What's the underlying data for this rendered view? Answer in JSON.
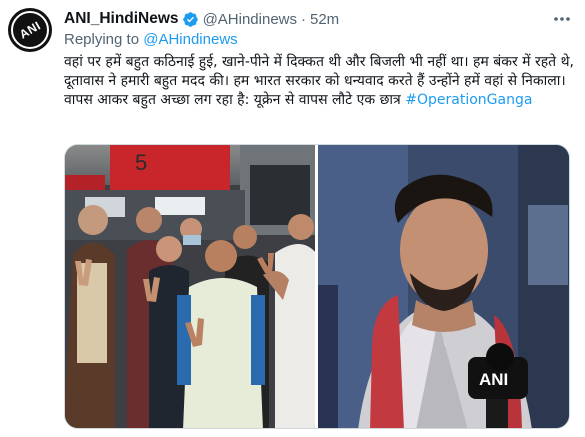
{
  "tweet": {
    "display_name": "ANI_HindiNews",
    "handle": "@AHindinews",
    "separator": "·",
    "time": "52m",
    "reply_prefix": "Replying to",
    "reply_handle": "@AHindinews",
    "text": "वहां पर हमें बहुत कठिनाई हुई, खाने-पीने में दिक्कत थी और बिजली भी नहीं था। हम बंकर में रहते थे, दूतावास ने हमारी बहुत मदद की। हम भारत सरकार को धन्यवाद करते हैं उन्होंने हमें वहां से निकाला। वापस आकर बहुत अच्छा लग रहा है: यूक्रेन से वापस लौटे एक छात्र",
    "hashtag": "#OperationGanga",
    "avatar_logo_text": "ANI",
    "photo_logo_text": "ANI",
    "board_number": "5",
    "verified_icon": "verified-badge-icon",
    "more_icon": "more-horizontal-icon"
  },
  "colors": {
    "link": "#1d9bf0",
    "secondary_text": "#536471",
    "primary_text": "#0f1419",
    "verified": "#1d9bf0"
  }
}
